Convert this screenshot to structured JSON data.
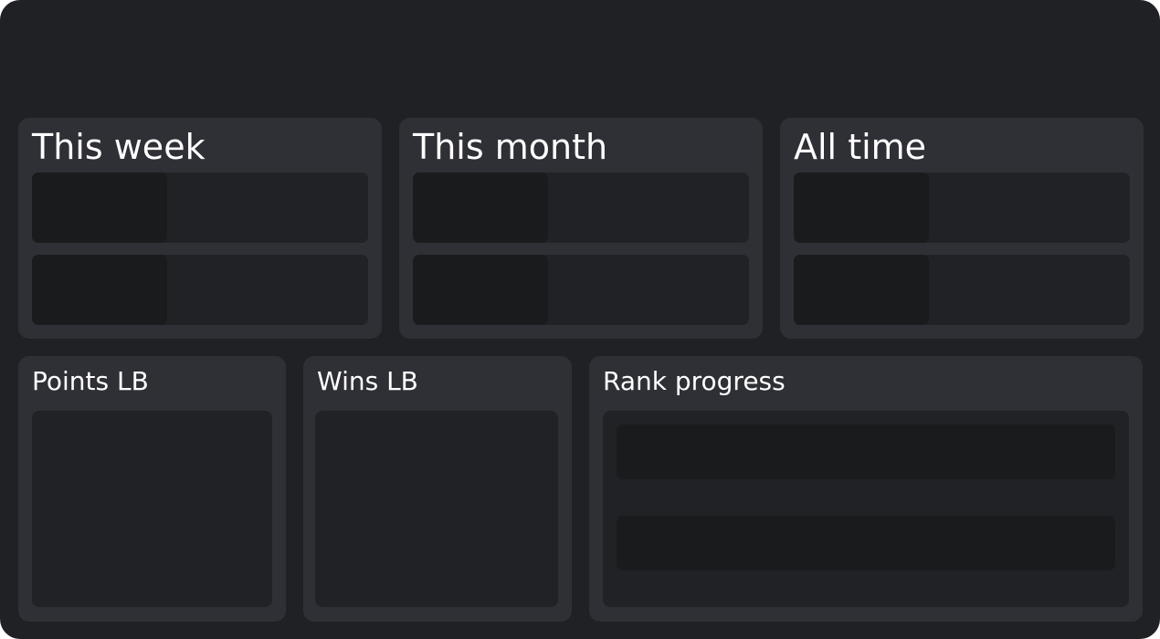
{
  "periods": [
    {
      "title": "This week"
    },
    {
      "title": "This month"
    },
    {
      "title": "All time"
    }
  ],
  "leaderboards": {
    "points_title": "Points LB",
    "wins_title": "Wins LB"
  },
  "rank_progress": {
    "title": "Rank progress"
  },
  "colors": {
    "background": "#202125",
    "panel": "#2f3036",
    "inset": "#212226",
    "inset_dark": "#1a1b1d",
    "text": "#ffffff"
  }
}
